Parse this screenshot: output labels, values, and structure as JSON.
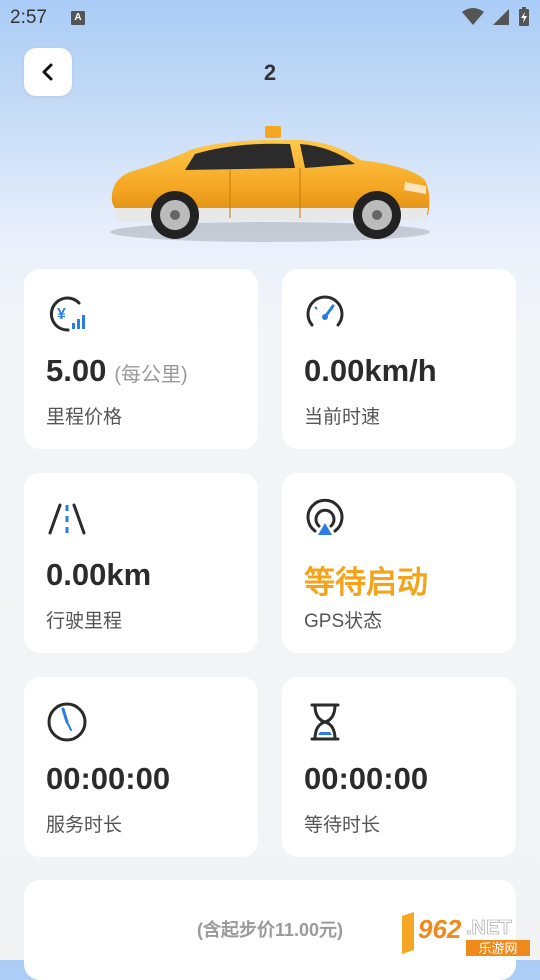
{
  "status_bar": {
    "time": "2:57",
    "notif_letter": "A"
  },
  "header": {
    "title": "2"
  },
  "cards": {
    "price": {
      "value": "5.00",
      "unit": "(每公里)",
      "label": "里程价格",
      "icon": "yen-signal-icon"
    },
    "speed": {
      "value": "0.00km/h",
      "label": "当前时速",
      "icon": "speedometer-icon"
    },
    "distance": {
      "value": "0.00km",
      "label": "行驶里程",
      "icon": "road-icon"
    },
    "gps": {
      "value": "等待启动",
      "label": "GPS状态",
      "icon": "gps-signal-icon"
    },
    "service_time": {
      "value": "00:00:00",
      "label": "服务时长",
      "icon": "clock-icon"
    },
    "wait_time": {
      "value": "00:00:00",
      "label": "等待时长",
      "icon": "hourglass-icon"
    }
  },
  "bottom": {
    "start_price_text": "(含起步价11.00元)"
  },
  "watermark": {
    "brand_number": "962",
    "brand_suffix": ".NET",
    "brand_sub": "乐游网"
  },
  "colors": {
    "accent_blue": "#2a7de1",
    "accent_orange": "#f4a31b"
  }
}
